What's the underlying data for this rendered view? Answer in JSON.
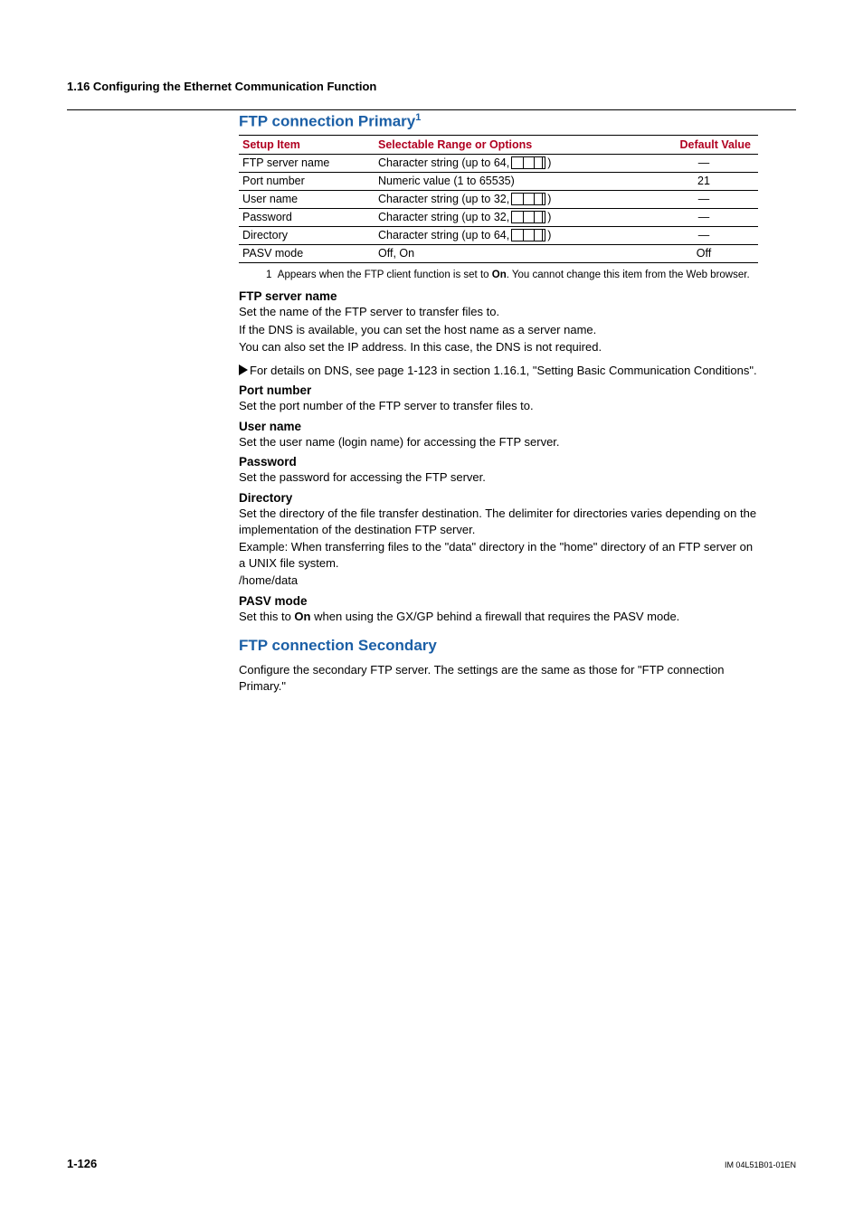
{
  "section_header": "1.16  Configuring the Ethernet Communication Function",
  "primary": {
    "heading": "FTP connection Primary",
    "heading_sup": "1",
    "table": {
      "headers": {
        "item": "Setup Item",
        "range": "Selectable Range or Options",
        "default": "Default Value"
      },
      "rows": [
        {
          "item": "FTP server name",
          "range_prefix": "Character string (up to 64,",
          "range_suffix": ")",
          "has_icon": true,
          "default": "―"
        },
        {
          "item": "Port number",
          "range_full": "Numeric value (1 to 65535)",
          "has_icon": false,
          "default": "21"
        },
        {
          "item": "User name",
          "range_prefix": "Character string (up to 32,",
          "range_suffix": " )",
          "has_icon": true,
          "default": "―"
        },
        {
          "item": "Password",
          "range_prefix": "Character string (up to 32,",
          "range_suffix": ")",
          "has_icon": true,
          "default": "―"
        },
        {
          "item": "Directory",
          "range_prefix": "Character string (up to 64,",
          "range_suffix": ")",
          "has_icon": true,
          "default": "―"
        },
        {
          "item": "PASV mode",
          "range_full": "Off, On",
          "has_icon": false,
          "default": "Off"
        }
      ]
    },
    "footnote": {
      "num": "1",
      "text_a": "Appears when the FTP client function is set to ",
      "bold": "On",
      "text_b": ". You cannot change this item from the Web browser."
    }
  },
  "descriptions": [
    {
      "title": "FTP server name",
      "paras": [
        "Set the name of the FTP server to transfer files to.",
        "If the DNS is available, you can set the host name as a server name.",
        "You can also set the IP address. In this case, the DNS is not required."
      ],
      "xref": "For details on DNS, see page 1-123 in section 1.16.1, \"Setting Basic Communication Conditions\"."
    },
    {
      "title": "Port number",
      "paras": [
        "Set the port number of the FTP server to transfer files to."
      ]
    },
    {
      "title": "User name",
      "paras": [
        "Set the user name (login name) for accessing the FTP server."
      ]
    },
    {
      "title": "Password",
      "paras": [
        "Set the password for accessing the FTP server."
      ]
    },
    {
      "title": "Directory",
      "paras": [
        "Set the directory of the file transfer destination. The delimiter for directories varies depending on the implementation of the destination FTP server.",
        "Example: When transferring files to the \"data\" directory in the \"home\" directory of an FTP server on a UNIX file system.",
        "/home/data"
      ]
    },
    {
      "title": "PASV mode",
      "paras_rich": {
        "pre": "Set this to ",
        "bold": "On",
        "post": " when using the GX/GP behind a firewall that requires the PASV mode."
      }
    }
  ],
  "secondary": {
    "heading": "FTP connection Secondary",
    "para": "Configure the secondary FTP server. The settings are the same as those for \"FTP connection Primary.\""
  },
  "footer": {
    "page": "1-126",
    "doc": "IM 04L51B01-01EN"
  }
}
